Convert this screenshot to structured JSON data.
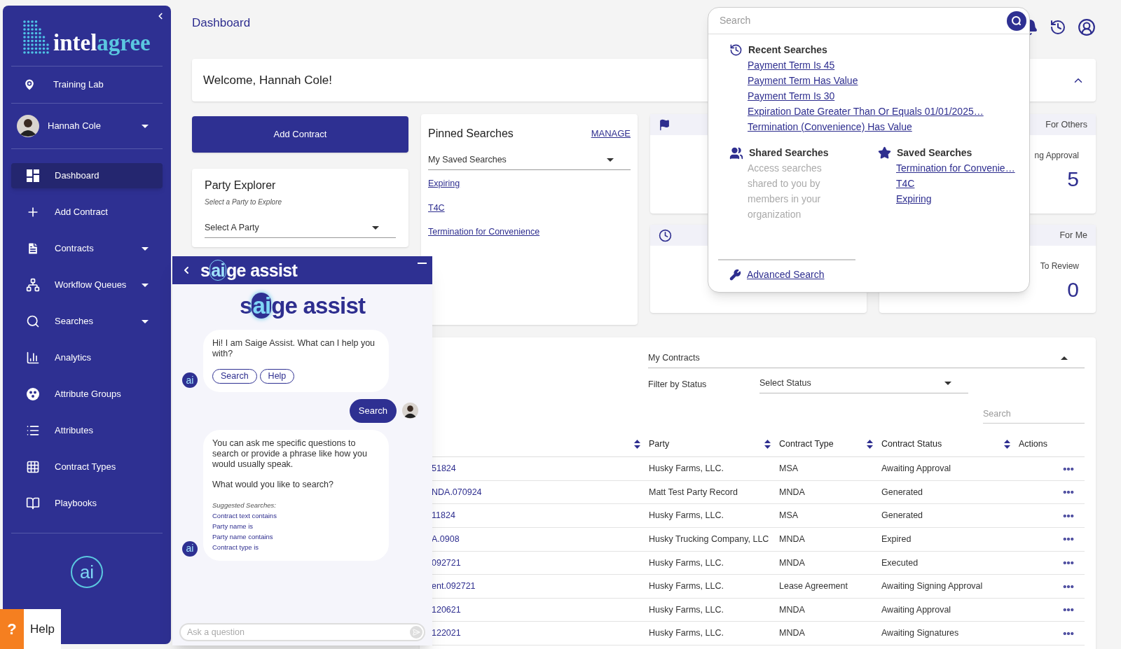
{
  "sidebar": {
    "logo": {
      "text": "intel",
      "accent": "agree"
    },
    "location": "Training Lab",
    "user": {
      "name": "Hannah Cole"
    },
    "items": [
      {
        "label": "Dashboard",
        "selected": true,
        "has_submenu": false
      },
      {
        "label": "Add Contract",
        "selected": false,
        "has_submenu": false
      },
      {
        "label": "Contracts",
        "selected": false,
        "has_submenu": true
      },
      {
        "label": "Workflow Queues",
        "selected": false,
        "has_submenu": true
      },
      {
        "label": "Searches",
        "selected": false,
        "has_submenu": true
      },
      {
        "label": "Analytics",
        "selected": false,
        "has_submenu": false
      },
      {
        "label": "Attribute Groups",
        "selected": false,
        "has_submenu": false
      },
      {
        "label": "Attributes",
        "selected": false,
        "has_submenu": false
      },
      {
        "label": "Contract Types",
        "selected": false,
        "has_submenu": false
      },
      {
        "label": "Playbooks",
        "selected": false,
        "has_submenu": false
      }
    ],
    "assistant_badge": "ai"
  },
  "help": {
    "mark": "?",
    "label": "Help"
  },
  "header": {
    "title": "Dashboard"
  },
  "welcome": {
    "text": "Welcome, Hannah Cole!",
    "expanded": true
  },
  "add_contract_button": "Add Contract",
  "party_explorer": {
    "title": "Party Explorer",
    "subtitle": "Select a Party to Explore",
    "select": "Select A Party"
  },
  "pinned_searches": {
    "title": "Pinned Searches",
    "action": "MANAGE",
    "select": "My Saved Searches",
    "links": [
      "Expiring",
      "T4C",
      "Termination for Convenience"
    ]
  },
  "stat_cards": [
    {
      "kind": "icon"
    },
    {
      "kind": "count",
      "header": "For Others",
      "label": "ng Approval",
      "value": "5"
    },
    {
      "kind": "icon"
    },
    {
      "kind": "count",
      "header": "For Me",
      "label": "To Review",
      "value": "0"
    }
  ],
  "contracts": {
    "view_select": "My Contracts",
    "filter_label": "Filter by Status",
    "status_select": "Select Status",
    "search_placeholder": "Search",
    "columns": [
      {
        "sortable": true
      },
      {
        "label": "Party",
        "sortable": true
      },
      {
        "label": "Contract Type",
        "sortable": true
      },
      {
        "label": "Contract Status",
        "sortable": true
      },
      {
        "label": "Actions",
        "sortable": false
      }
    ],
    "rows": [
      {
        "column_1": "51824",
        "party": "Husky Farms, LLC.",
        "contract_type": "MSA",
        "contract_status": "Awaiting Approval"
      },
      {
        "column_1": "NDA.070924",
        "party": "Matt Test Party Record",
        "contract_type": "MNDA",
        "contract_status": "Generated"
      },
      {
        "column_1": "11824",
        "party": "Husky Farms, LLC.",
        "contract_type": "MSA",
        "contract_status": "Generated"
      },
      {
        "column_1": "A.0908",
        "party": "Husky Trucking Company, LLC",
        "contract_type": "MNDA",
        "contract_status": "Expired"
      },
      {
        "column_1": "092721",
        "party": "Husky Farms, LLC.",
        "contract_type": "MNDA",
        "contract_status": "Executed"
      },
      {
        "column_1": "ent.092721",
        "party": "Husky Farms, LLC.",
        "contract_type": "Lease Agreement",
        "contract_status": "Awaiting Signing Approval"
      },
      {
        "column_1": "120621",
        "party": "Husky Farms, LLC.",
        "contract_type": "MNDA",
        "contract_status": "Awaiting Approval"
      },
      {
        "column_1": "122021",
        "party": "Husky Farms, LLC.",
        "contract_type": "MNDA",
        "contract_status": "Awaiting Signatures"
      }
    ]
  },
  "search_popup": {
    "placeholder": "Search",
    "recent": {
      "title": "Recent Searches",
      "items": [
        "Payment Term Is 45",
        "Payment Term Has Value",
        "Payment Term Is 30",
        "Expiration Date Greater Than Or Equals 01/01/2025…",
        "Termination (Convenience) Has Value"
      ]
    },
    "shared": {
      "title": "Shared Searches",
      "text": "Access searches shared to you by members in your organization"
    },
    "saved": {
      "title": "Saved Searches",
      "items": [
        "Termination for Convenie…",
        "T4C",
        "Expiring"
      ]
    },
    "advanced": "Advanced Search"
  },
  "chat": {
    "header_brand": [
      "s",
      "ai",
      "ge assist"
    ],
    "brand": [
      "s",
      "ai",
      "ge assist"
    ],
    "messages": [
      {
        "kind": "bot",
        "badge": "ai",
        "text": "Hi! I am Saige Assist. What can I help you with?",
        "buttons": [
          "Search",
          "Help"
        ]
      },
      {
        "kind": "user",
        "text": "Search"
      },
      {
        "kind": "bot",
        "badge": "ai",
        "text": "You can ask me specific questions to search or provide a phrase like how you would usually speak.",
        "question": "What would you like to search?",
        "suggest_title": "Suggested Searches:",
        "suggestions": [
          "Contract text contains",
          "Party name is",
          "Party name contains",
          "Contract type is"
        ]
      }
    ],
    "input_placeholder": "Ask a question"
  }
}
